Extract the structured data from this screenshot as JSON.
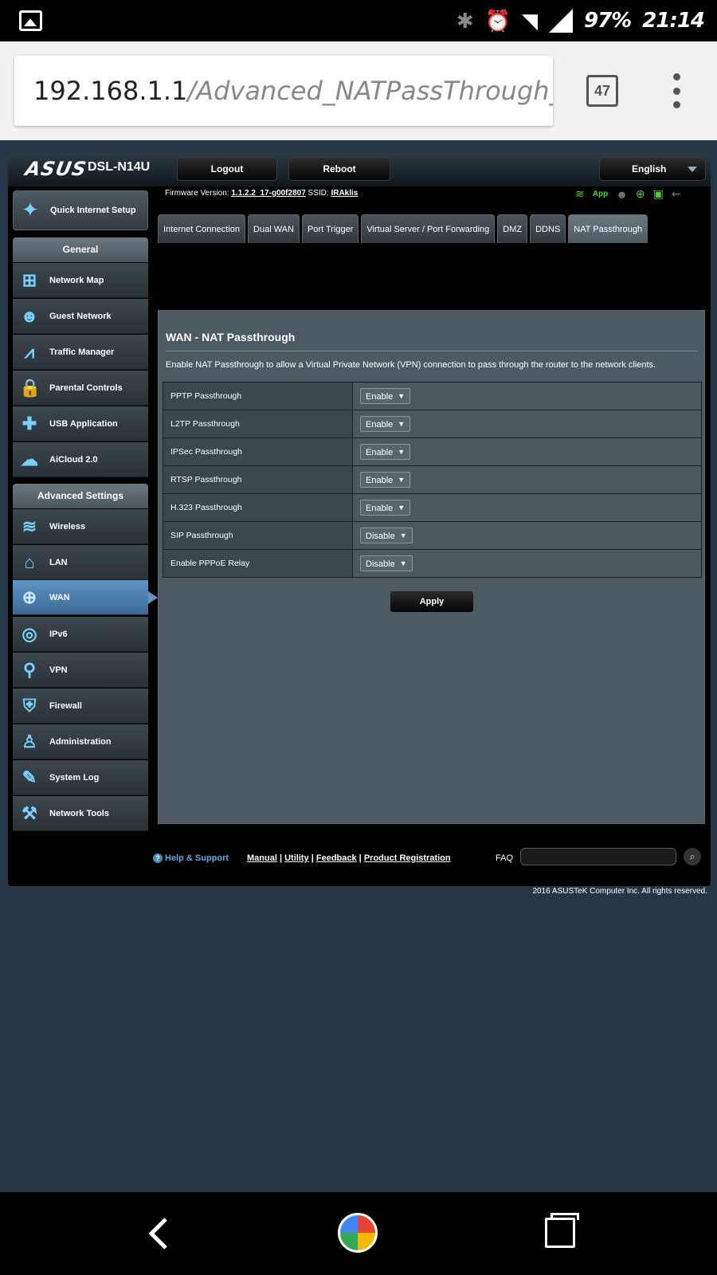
{
  "status_bar": {
    "battery": "97%",
    "time": "21:14",
    "icons": [
      "image-icon",
      "bluetooth-icon",
      "alarm-icon",
      "wifi-icon",
      "signal-icon"
    ]
  },
  "browser": {
    "url_host": "192.168.1.1",
    "url_path": "/Advanced_NATPassThrough_Con",
    "tab_count": "47"
  },
  "header": {
    "logo": "ASUS",
    "model": "DSL-N14U",
    "logout": "Logout",
    "reboot": "Reboot",
    "language": "English"
  },
  "firmware": {
    "label": "Firmware Version:",
    "version": "1.1.2.2_17-g00f2807",
    "ssid_label": "SSID:",
    "ssid": "IRAklis",
    "app": "App"
  },
  "sidebar": {
    "quick_setup": "Quick Internet Setup",
    "general_title": "General",
    "general": [
      {
        "label": "Network Map",
        "icon": "network-map-icon"
      },
      {
        "label": "Guest Network",
        "icon": "guest-network-icon"
      },
      {
        "label": "Traffic Manager",
        "icon": "traffic-manager-icon"
      },
      {
        "label": "Parental Controls",
        "icon": "lock-icon"
      },
      {
        "label": "USB Application",
        "icon": "puzzle-icon"
      },
      {
        "label": "AiCloud 2.0",
        "icon": "cloud-icon"
      }
    ],
    "advanced_title": "Advanced Settings",
    "advanced": [
      {
        "label": "Wireless",
        "icon": "wifi-icon"
      },
      {
        "label": "LAN",
        "icon": "home-icon"
      },
      {
        "label": "WAN",
        "icon": "globe-icon"
      },
      {
        "label": "IPv6",
        "icon": "ipv6-icon"
      },
      {
        "label": "VPN",
        "icon": "vpn-icon"
      },
      {
        "label": "Firewall",
        "icon": "shield-icon"
      },
      {
        "label": "Administration",
        "icon": "user-icon"
      },
      {
        "label": "System Log",
        "icon": "edit-icon"
      },
      {
        "label": "Network Tools",
        "icon": "wrench-icon"
      }
    ]
  },
  "tabs": [
    "Internet Connection",
    "Dual WAN",
    "Port Trigger",
    "Virtual Server / Port Forwarding",
    "DMZ",
    "DDNS",
    "NAT Passthrough"
  ],
  "content": {
    "title": "WAN - NAT Passthrough",
    "description": "Enable NAT Passthrough to allow a Virtual Private Network (VPN) connection to pass through the router to the network clients.",
    "rows": [
      {
        "label": "PPTP Passthrough",
        "value": "Enable"
      },
      {
        "label": "L2TP Passthrough",
        "value": "Enable"
      },
      {
        "label": "IPSec Passthrough",
        "value": "Enable"
      },
      {
        "label": "RTSP Passthrough",
        "value": "Enable"
      },
      {
        "label": "H.323 Passthrough",
        "value": "Enable"
      },
      {
        "label": "SIP Passthrough",
        "value": "Disable"
      },
      {
        "label": "Enable PPPoE Relay",
        "value": "Disable"
      }
    ],
    "apply": "Apply"
  },
  "footer": {
    "help": "Help & Support",
    "manual": "Manual",
    "utility": "Utility",
    "feedback": "Feedback",
    "product_registration": "Product Registration",
    "faq": "FAQ",
    "copyright": "2016 ASUSTeK Computer Inc. All rights reserved."
  }
}
